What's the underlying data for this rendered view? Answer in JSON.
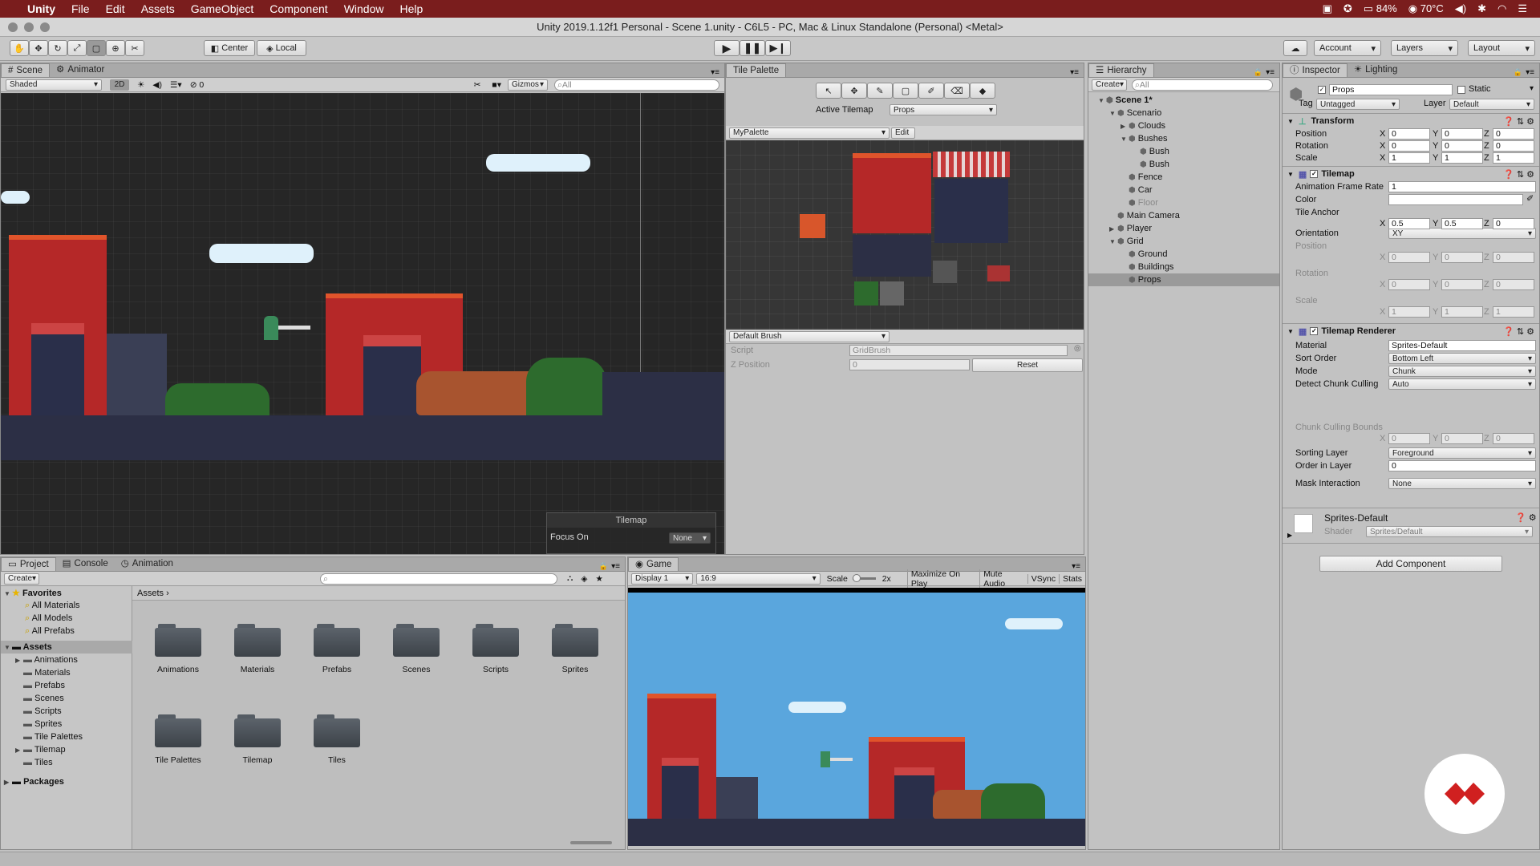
{
  "menubar": {
    "app": "Unity",
    "items": [
      "File",
      "Edit",
      "Assets",
      "GameObject",
      "Component",
      "Window",
      "Help"
    ],
    "battery": "84%",
    "temp": "70°C"
  },
  "window_title": "Unity 2019.1.12f1 Personal - Scene 1.unity - C6L5 - PC, Mac & Linux Standalone (Personal) <Metal>",
  "toolbar": {
    "pivot": "Center",
    "space": "Local",
    "account": "Account",
    "layers": "Layers",
    "layout": "Layout"
  },
  "scene": {
    "tabs": [
      "Scene",
      "Animator"
    ],
    "shading": "Shaded",
    "mode2d": "2D",
    "fx_count": "0",
    "gizmos": "Gizmos",
    "search_placeholder": "All",
    "overlay_title": "Tilemap",
    "focus_label": "Focus On",
    "focus_value": "None"
  },
  "tile_palette": {
    "tab": "Tile Palette",
    "active_label": "Active Tilemap",
    "active_value": "Props",
    "palette": "MyPalette",
    "edit": "Edit",
    "brush": "Default Brush",
    "script_label": "Script",
    "script_value": "GridBrush",
    "zpos_label": "Z Position",
    "zpos_value": "0",
    "reset": "Reset"
  },
  "hierarchy": {
    "tab": "Hierarchy",
    "create": "Create",
    "search_placeholder": "All",
    "items": [
      {
        "label": "Scene 1*",
        "indent": 0,
        "arrow": "▼",
        "bold": true
      },
      {
        "label": "Scenario",
        "indent": 1,
        "arrow": "▼"
      },
      {
        "label": "Clouds",
        "indent": 2,
        "arrow": "▶"
      },
      {
        "label": "Bushes",
        "indent": 2,
        "arrow": "▼"
      },
      {
        "label": "Bush",
        "indent": 3,
        "arrow": ""
      },
      {
        "label": "Bush",
        "indent": 3,
        "arrow": ""
      },
      {
        "label": "Fence",
        "indent": 2,
        "arrow": ""
      },
      {
        "label": "Car",
        "indent": 2,
        "arrow": ""
      },
      {
        "label": "Floor",
        "indent": 2,
        "arrow": "",
        "dim": true
      },
      {
        "label": "Main Camera",
        "indent": 1,
        "arrow": ""
      },
      {
        "label": "Player",
        "indent": 1,
        "arrow": "▶"
      },
      {
        "label": "Grid",
        "indent": 1,
        "arrow": "▼"
      },
      {
        "label": "Ground",
        "indent": 2,
        "arrow": ""
      },
      {
        "label": "Buildings",
        "indent": 2,
        "arrow": ""
      },
      {
        "label": "Props",
        "indent": 2,
        "arrow": "",
        "selected": true
      }
    ]
  },
  "inspector": {
    "tabs": [
      "Inspector",
      "Lighting"
    ],
    "object_name": "Props",
    "static": "Static",
    "tag_label": "Tag",
    "tag_value": "Untagged",
    "layer_label": "Layer",
    "layer_value": "Default",
    "transform": {
      "title": "Transform",
      "position": {
        "label": "Position",
        "x": "0",
        "y": "0",
        "z": "0"
      },
      "rotation": {
        "label": "Rotation",
        "x": "0",
        "y": "0",
        "z": "0"
      },
      "scale": {
        "label": "Scale",
        "x": "1",
        "y": "1",
        "z": "1"
      }
    },
    "tilemap": {
      "title": "Tilemap",
      "anim_label": "Animation Frame Rate",
      "anim_value": "1",
      "color_label": "Color",
      "anchor_label": "Tile Anchor",
      "anchor_x": "0.5",
      "anchor_y": "0.5",
      "anchor_z": "0",
      "orient_label": "Orientation",
      "orient_value": "XY",
      "pos_label": "Position",
      "rot_label": "Rotation",
      "scale_label": "Scale",
      "zero": "0",
      "one": "1"
    },
    "renderer": {
      "title": "Tilemap Renderer",
      "material_label": "Material",
      "material_value": "Sprites-Default",
      "sort_label": "Sort Order",
      "sort_value": "Bottom Left",
      "mode_label": "Mode",
      "mode_value": "Chunk",
      "detect_label": "Detect Chunk Culling",
      "detect_value": "Auto",
      "bounds_label": "Chunk Culling Bounds",
      "layer_label": "Sorting Layer",
      "layer_value": "Foreground",
      "order_label": "Order in Layer",
      "order_value": "0",
      "mask_label": "Mask Interaction",
      "mask_value": "None"
    },
    "material": {
      "title": "Sprites-Default",
      "shader_label": "Shader",
      "shader_value": "Sprites/Default"
    },
    "add_component": "Add Component"
  },
  "project": {
    "tabs": [
      "Project",
      "Console",
      "Animation"
    ],
    "create": "Create",
    "breadcrumb": "Assets",
    "favorites_title": "Favorites",
    "favorites": [
      "All Materials",
      "All Models",
      "All Prefabs"
    ],
    "assets_title": "Assets",
    "tree": [
      {
        "label": "Animations",
        "arrow": "▶"
      },
      {
        "label": "Materials",
        "arrow": ""
      },
      {
        "label": "Prefabs",
        "arrow": ""
      },
      {
        "label": "Scenes",
        "arrow": ""
      },
      {
        "label": "Scripts",
        "arrow": ""
      },
      {
        "label": "Sprites",
        "arrow": ""
      },
      {
        "label": "Tile Palettes",
        "arrow": ""
      },
      {
        "label": "Tilemap",
        "arrow": "▶"
      },
      {
        "label": "Tiles",
        "arrow": ""
      }
    ],
    "packages": "Packages",
    "folders": [
      "Animations",
      "Materials",
      "Prefabs",
      "Scenes",
      "Scripts",
      "Sprites",
      "Tile Palettes",
      "Tilemap",
      "Tiles"
    ]
  },
  "game": {
    "tab": "Game",
    "display": "Display 1",
    "aspect": "16:9",
    "scale_label": "Scale",
    "scale_value": "2x",
    "maximize": "Maximize On Play",
    "mute": "Mute Audio",
    "vsync": "VSync",
    "stats": "Stats"
  },
  "colors": {
    "menubar": "#7a1d1d",
    "selection": "#3e7de0",
    "sky": "#5aa6dd"
  }
}
